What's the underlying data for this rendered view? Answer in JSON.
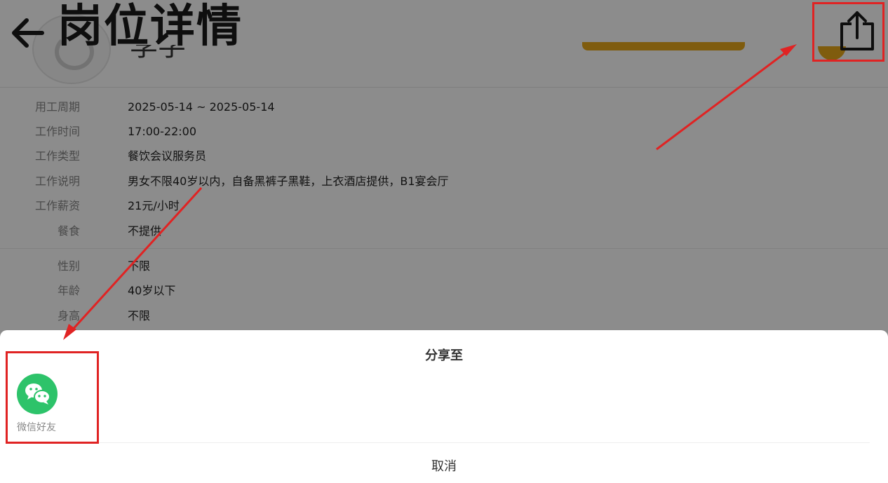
{
  "header": {
    "title": "岗位详情",
    "name_partial": "李学"
  },
  "details": [
    {
      "label": "用工周期",
      "value": "2025-05-14 ~ 2025-05-14"
    },
    {
      "label": "工作时间",
      "value": "17:00-22:00"
    },
    {
      "label": "工作类型",
      "value": "餐饮会议服务员"
    },
    {
      "label": "工作说明",
      "value": "男女不限40岁以内，自备黑裤子黑鞋，上衣酒店提供，B1宴会厅"
    },
    {
      "label": "工作薪资",
      "value": "21元/小时"
    },
    {
      "label": "餐食",
      "value": "不提供"
    }
  ],
  "requirements": [
    {
      "label": "性别",
      "value": "不限"
    },
    {
      "label": "年龄",
      "value": "40岁以下"
    },
    {
      "label": "身高",
      "value": "不限"
    }
  ],
  "share_sheet": {
    "title": "分享至",
    "targets": [
      {
        "label": "微信好友",
        "icon": "wechat-icon"
      }
    ],
    "cancel_label": "取消"
  },
  "colors": {
    "accent_green": "#2dc36a",
    "highlight_red": "#e02323",
    "banner_orange": "#e8a81a"
  }
}
